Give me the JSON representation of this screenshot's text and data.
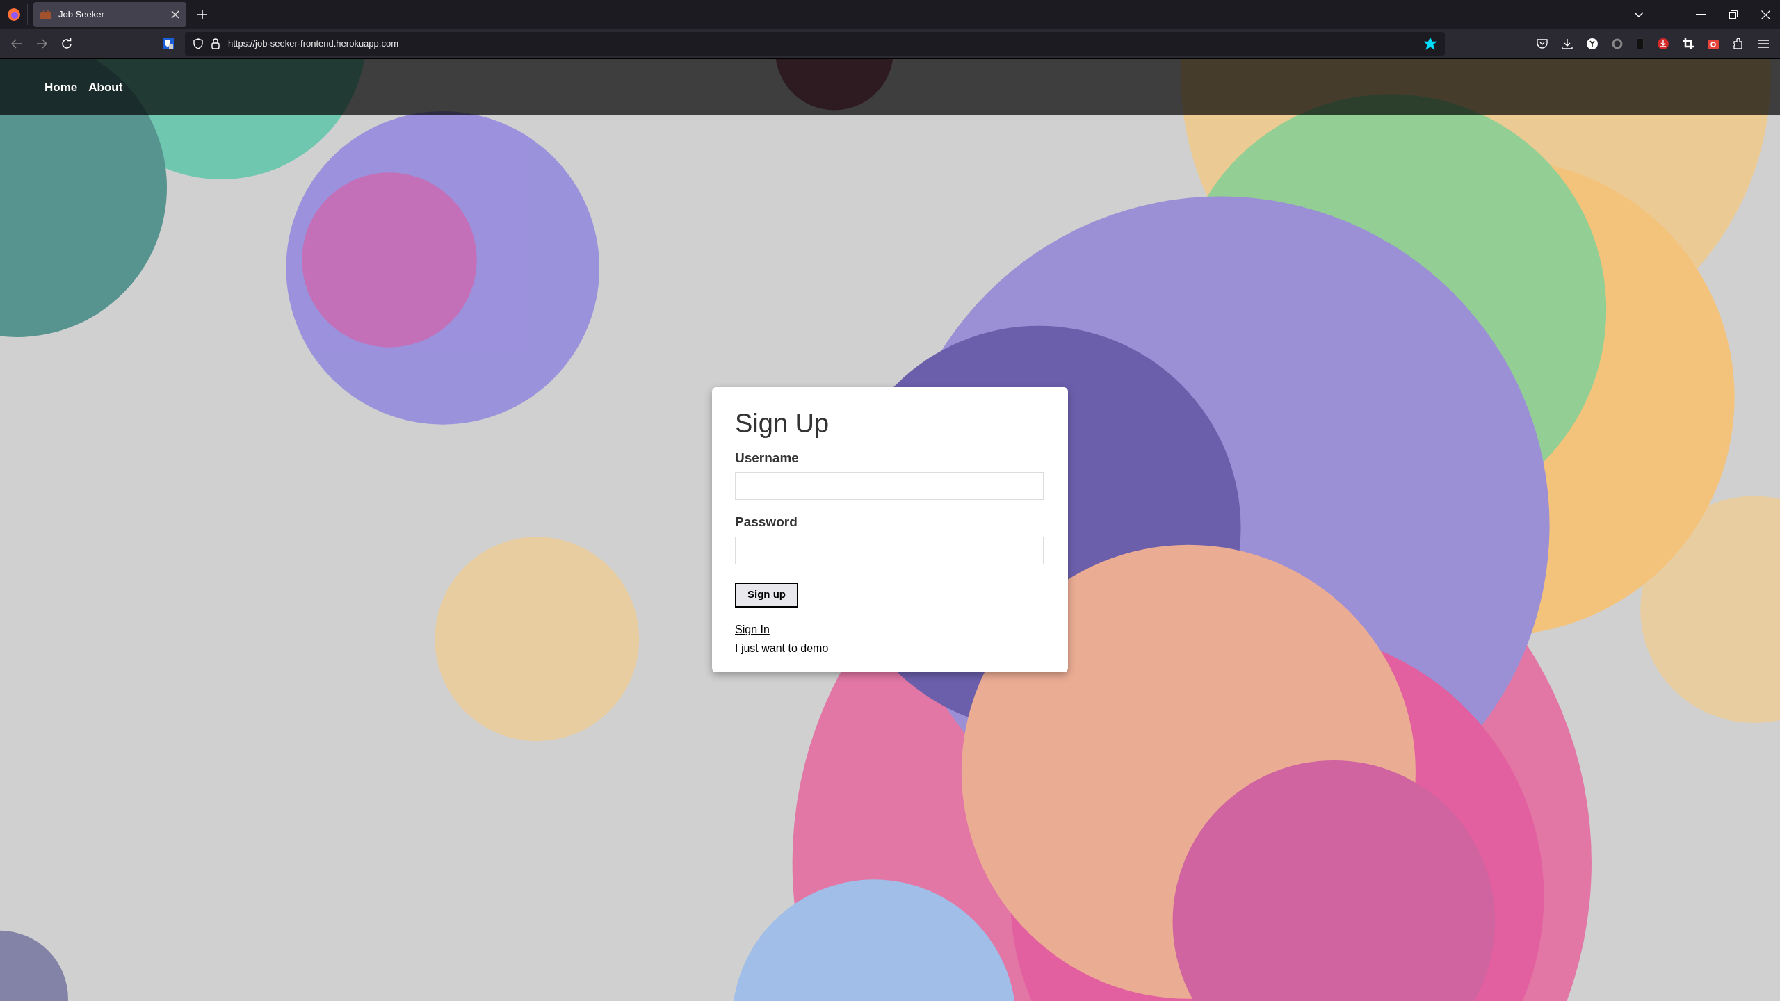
{
  "browser": {
    "tab": {
      "title": "Job Seeker",
      "selected": true
    },
    "url": "https://job-seeker-frontend.herokuapp.com",
    "bookmarked": true
  },
  "nav": {
    "links": [
      {
        "label": "Home"
      },
      {
        "label": "About"
      }
    ]
  },
  "form": {
    "title": "Sign Up",
    "fields": [
      {
        "label": "Username"
      },
      {
        "label": "Password"
      }
    ],
    "submit": "Sign up",
    "links": [
      "Sign In",
      "I just want to demo"
    ]
  }
}
